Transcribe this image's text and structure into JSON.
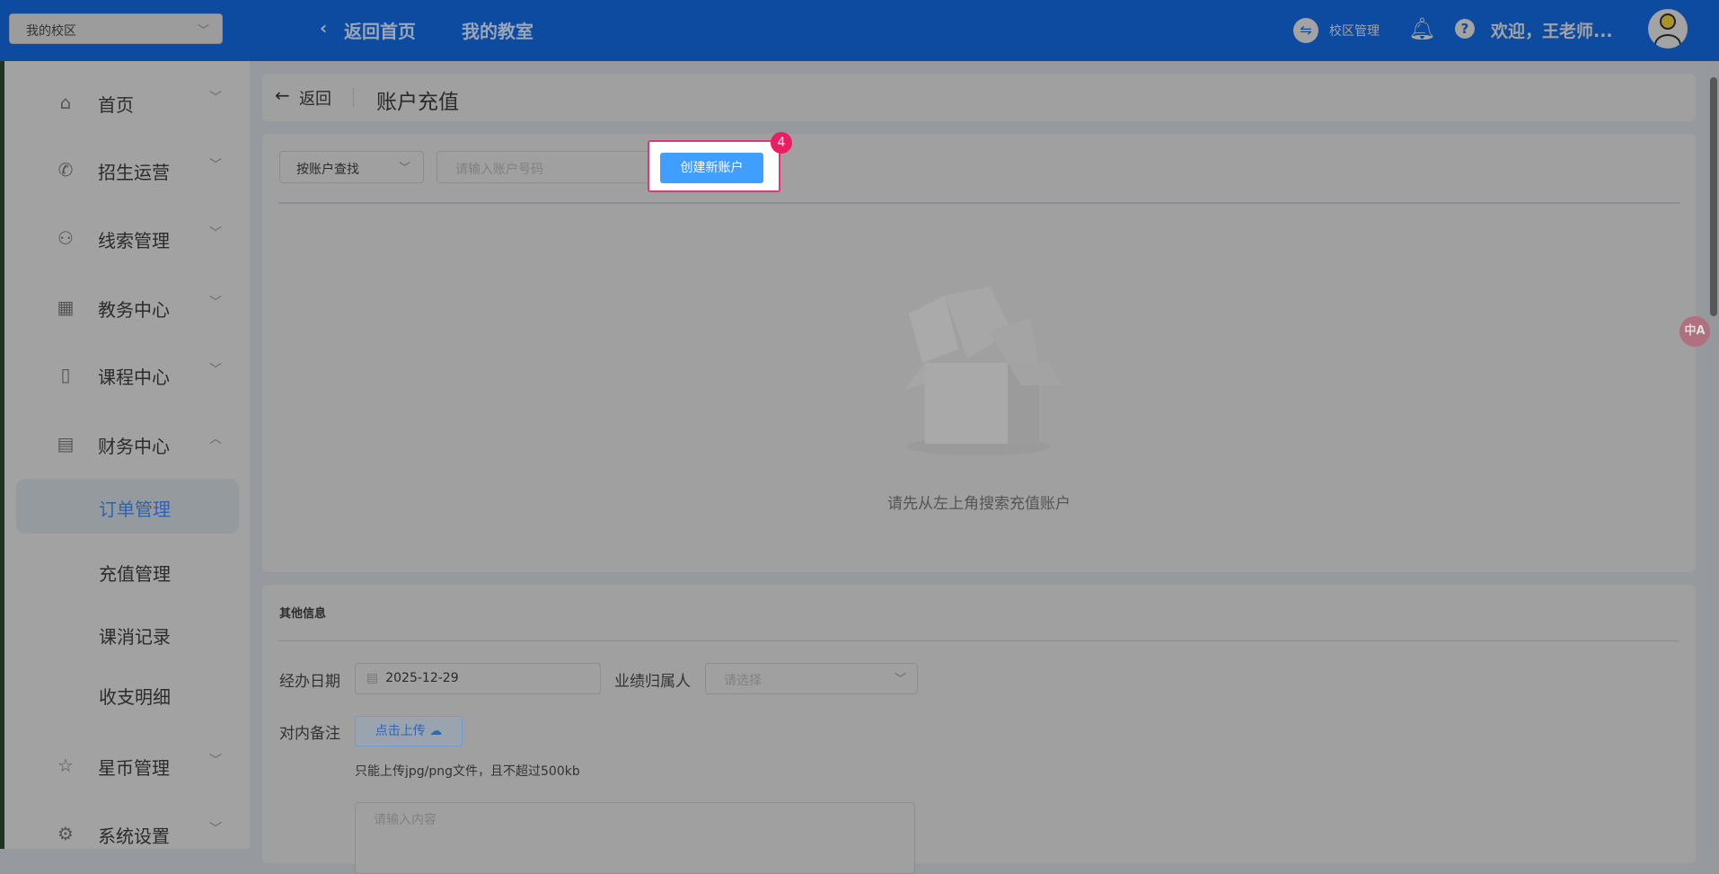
{
  "header": {
    "campus_select": "我的校区",
    "back_home": "返回首页",
    "my_classroom": "我的教室",
    "campus_manage": "校区管理",
    "welcome": "欢迎，王老师..."
  },
  "sidebar": {
    "items": [
      {
        "label": "首页"
      },
      {
        "label": "招生运营"
      },
      {
        "label": "线索管理"
      },
      {
        "label": "教务中心"
      },
      {
        "label": "课程中心"
      },
      {
        "label": "财务中心"
      }
    ],
    "sub_items": [
      {
        "label": "订单管理"
      },
      {
        "label": "充值管理"
      },
      {
        "label": "课消记录"
      },
      {
        "label": "收支明细"
      }
    ],
    "bottom_items": [
      {
        "label": "星币管理"
      },
      {
        "label": "系统设置"
      }
    ]
  },
  "page": {
    "back": "返回",
    "title": "账户充值"
  },
  "search": {
    "mode": "按账户查找",
    "placeholder": "请输入账户号码",
    "create_button": "创建新账户",
    "step_badge": "4",
    "empty_text": "请先从左上角搜索充值账户"
  },
  "other": {
    "title": "其他信息",
    "date_label": "经办日期",
    "date_value": "2025-12-29",
    "owner_label": "业绩归属人",
    "owner_placeholder": "请选择",
    "remark_label": "对内备注",
    "upload_button": "点击上传",
    "upload_hint": "只能上传jpg/png文件，且不超过500kb",
    "remark_placeholder": "请输入内容"
  },
  "colors": {
    "header": "#0d4ba0",
    "primary": "#409eff",
    "highlight": "#e6337a"
  }
}
